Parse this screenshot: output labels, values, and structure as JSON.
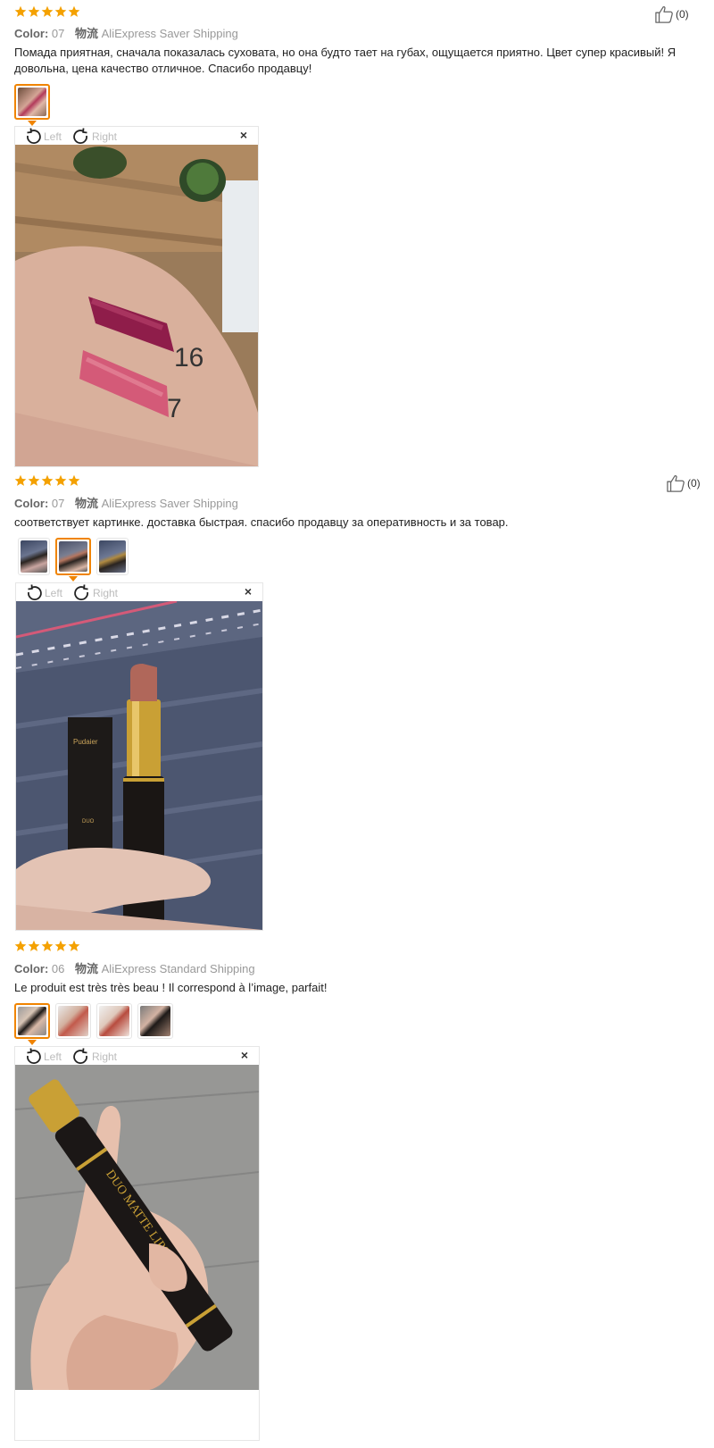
{
  "colors": {
    "star": "#f4a100",
    "active_border": "#f08400"
  },
  "icons": {
    "helpful": "thumbs-up-icon",
    "rotate_left": "rotate-left-icon",
    "rotate_right": "rotate-right-icon",
    "close": "close-icon",
    "star": "star-icon"
  },
  "common": {
    "color_label": "Color:",
    "shipping_label": "物流",
    "rotate_left_label": "Left",
    "rotate_right_label": "Right",
    "close_label": "×"
  },
  "reviews": [
    {
      "rating": 5,
      "color_value": "07",
      "shipping": "AliExpress Saver Shipping",
      "text": "Помада приятная, сначала показалась суховата, но она будто тает на губах, ощущается приятно. Цвет супер красивый! Я довольна, цена качество отличное. Спасибо продавцу!",
      "helpful_count": "(0)"
    },
    {
      "rating": 5,
      "color_value": "07",
      "shipping": "AliExpress Saver Shipping",
      "text": "соответствует картинке. доставка быстрая. спасибо продавцу за оперативность и за товар.",
      "helpful_count": "(0)"
    },
    {
      "rating": 5,
      "color_value": "06",
      "shipping": "AliExpress Standard Shipping",
      "text": "Le produit est très très beau ! Il correspond à l’image, parfait!"
    }
  ],
  "photo_text": {
    "swatch_labels": [
      "16",
      "7"
    ],
    "box_brand": "Pudaier",
    "box_label": "DUO",
    "pen_print": "DUO MATTE LIPSTICK"
  }
}
